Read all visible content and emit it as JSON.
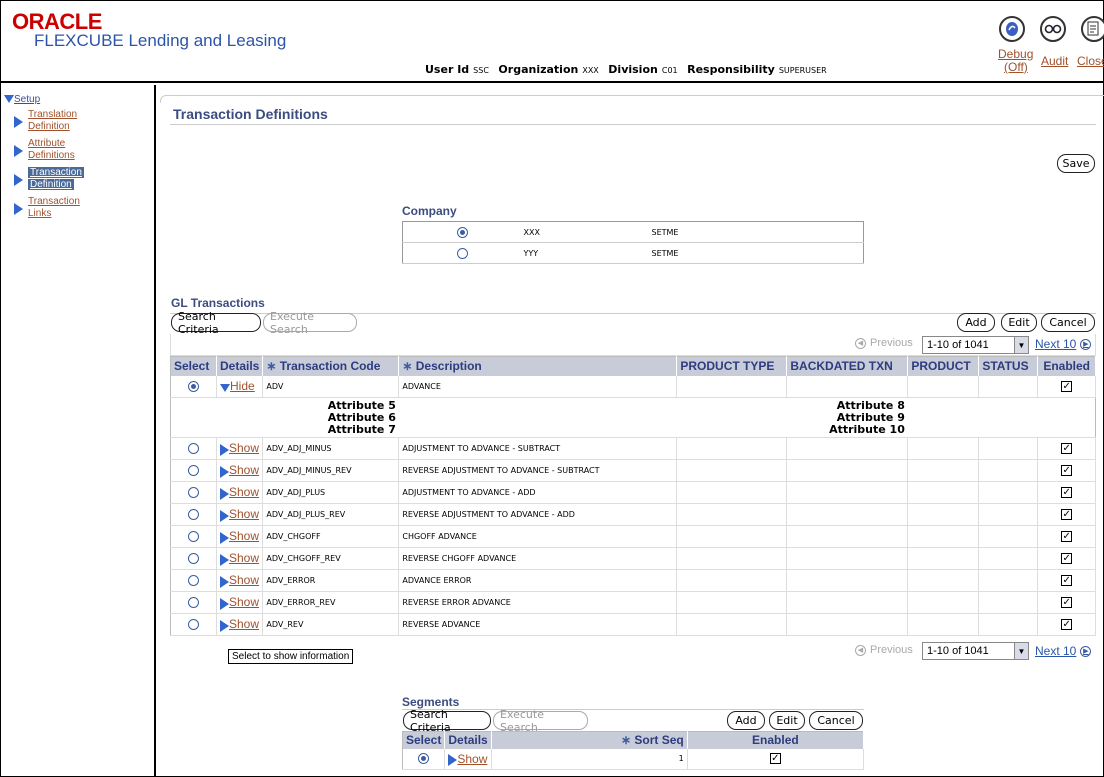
{
  "header": {
    "logo": "ORACLE",
    "product": "FLEXCUBE Lending and Leasing",
    "user_id_label": "User Id",
    "user_id": "SSC",
    "organization_label": "Organization",
    "organization": "XXX",
    "division_label": "Division",
    "division": "C01",
    "responsibility_label": "Responsibility",
    "responsibility": "SUPERUSER",
    "debug_label": "Debug",
    "debug_state": "(Off)",
    "audit_label": "Audit",
    "close_label": "Close"
  },
  "sidebar": {
    "root": "Setup",
    "items": [
      {
        "line1": "Translation",
        "line2": "Definition"
      },
      {
        "line1": "Attribute",
        "line2": "Definitions"
      },
      {
        "line1": "Transaction",
        "line2": "Definition"
      },
      {
        "line1": "Transaction",
        "line2": "Links"
      }
    ]
  },
  "main": {
    "title": "Transaction Definitions",
    "save_label": "Save"
  },
  "company": {
    "label": "Company",
    "rows": [
      {
        "selected": true,
        "code": "XXX",
        "name": "SETME"
      },
      {
        "selected": false,
        "code": "YYY",
        "name": "SETME"
      }
    ]
  },
  "gl": {
    "label": "GL Transactions",
    "search_criteria": "Search Criteria",
    "execute_search": "Execute Search",
    "add": "Add",
    "edit": "Edit",
    "cancel": "Cancel",
    "previous": "Previous",
    "range": "1-10 of 1041",
    "next": "Next 10",
    "columns": [
      "Select",
      "Details",
      "Transaction Code",
      "Description",
      "PRODUCT TYPE",
      "BACKDATED TXN",
      "PRODUCT",
      "STATUS",
      "Enabled"
    ],
    "hide_label": "Hide",
    "show_label": "Show",
    "expanded_row": {
      "code": "ADV",
      "description": "ADVANCE"
    },
    "attributes_left": [
      "Attribute 5",
      "Attribute 6",
      "Attribute 7"
    ],
    "attributes_right": [
      "Attribute 8",
      "Attribute 9",
      "Attribute 10"
    ],
    "rows": [
      {
        "code": "ADV_ADJ_MINUS",
        "description": "ADJUSTMENT TO ADVANCE - SUBTRACT"
      },
      {
        "code": "ADV_ADJ_MINUS_REV",
        "description": "REVERSE ADJUSTMENT TO ADVANCE - SUBTRACT"
      },
      {
        "code": "ADV_ADJ_PLUS",
        "description": "ADJUSTMENT TO ADVANCE - ADD"
      },
      {
        "code": "ADV_ADJ_PLUS_REV",
        "description": "REVERSE ADJUSTMENT TO ADVANCE - ADD"
      },
      {
        "code": "ADV_CHGOFF",
        "description": "CHGOFF ADVANCE"
      },
      {
        "code": "ADV_CHGOFF_REV",
        "description": "REVERSE CHGOFF ADVANCE"
      },
      {
        "code": "ADV_ERROR",
        "description": "ADVANCE ERROR"
      },
      {
        "code": "ADV_ERROR_REV",
        "description": "REVERSE ERROR ADVANCE"
      },
      {
        "code": "ADV_REV",
        "description": "REVERSE ADVANCE"
      }
    ],
    "tooltip": "Select to show information"
  },
  "segments": {
    "label": "Segments",
    "search_criteria": "Search Criteria",
    "execute_search": "Execute Search",
    "add": "Add",
    "edit": "Edit",
    "cancel": "Cancel",
    "columns": [
      "Select",
      "Details",
      "Sort Seq",
      "Enabled"
    ],
    "show_label": "Show",
    "row": {
      "sort_seq": "1"
    }
  }
}
